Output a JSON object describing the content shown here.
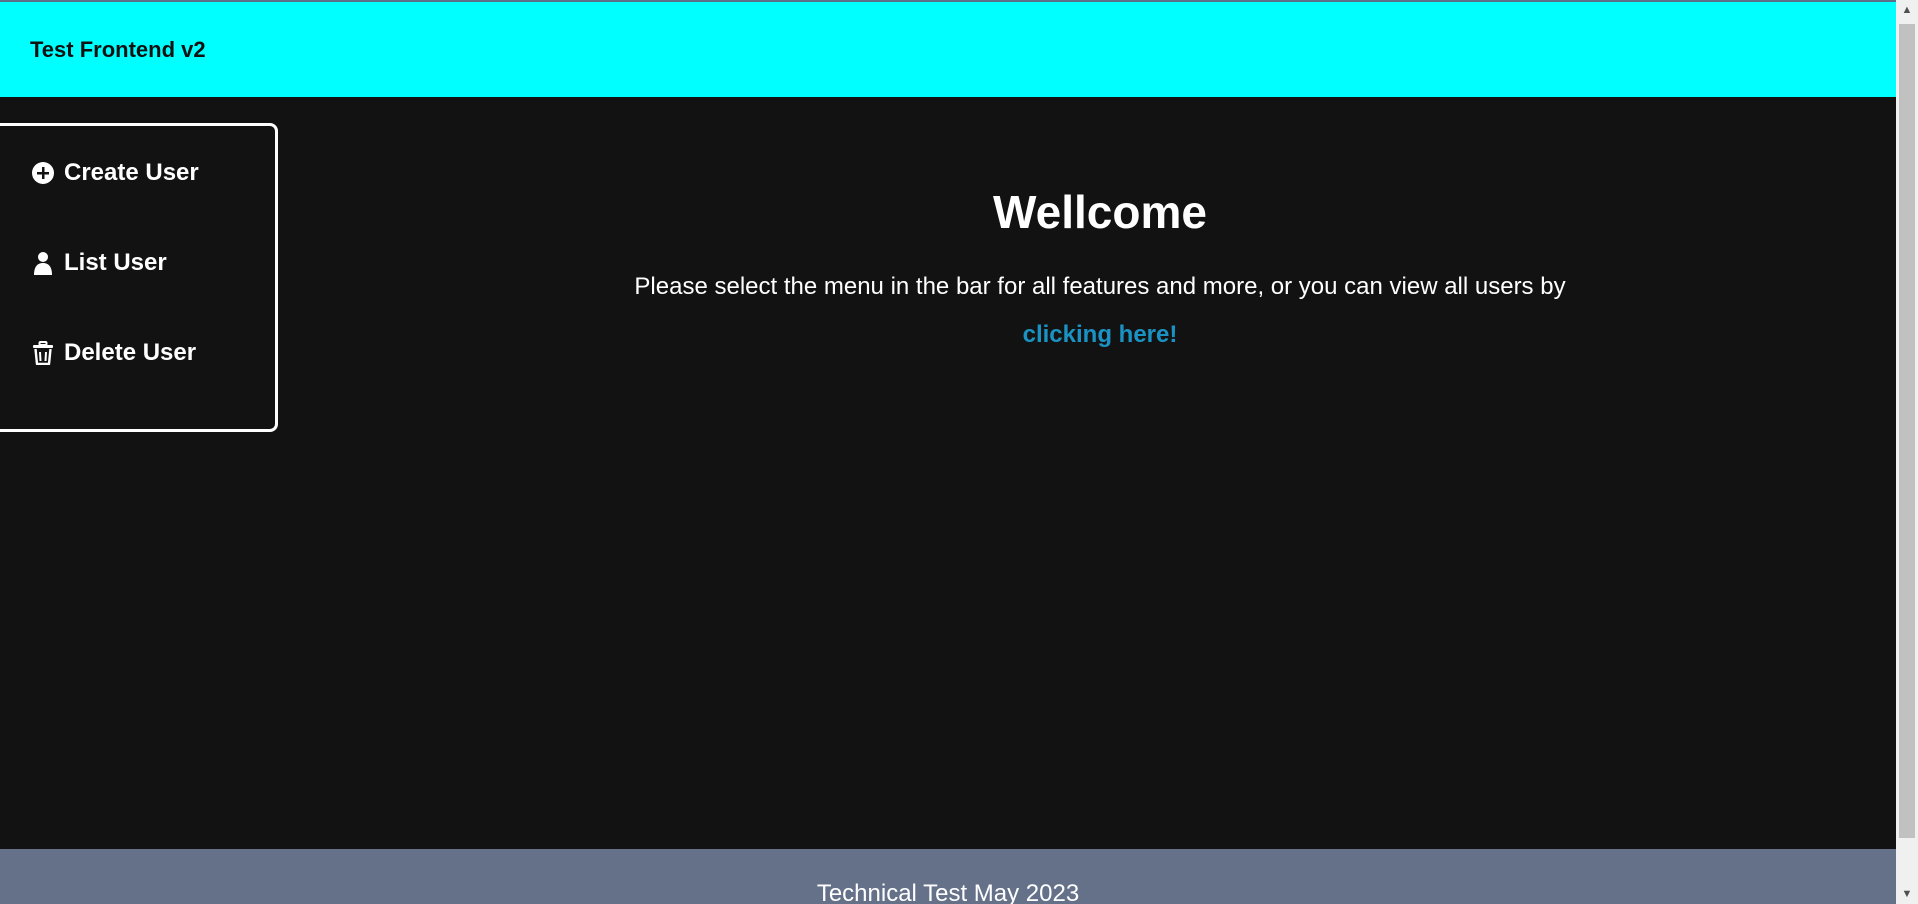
{
  "header": {
    "title": "Test Frontend v2"
  },
  "sidebar": {
    "items": [
      {
        "label": "Create User",
        "icon": "plus-circle-icon"
      },
      {
        "label": "List User",
        "icon": "user-icon"
      },
      {
        "label": "Delete User",
        "icon": "trash-icon"
      }
    ]
  },
  "main": {
    "title": "Wellcome",
    "text": "Please select the menu in the bar for all features and more, or you can view all users by",
    "link": "clicking here!"
  },
  "footer": {
    "text": "Technical Test May 2023"
  },
  "colors": {
    "header_bg": "#00ffff",
    "main_bg": "#121212",
    "link": "#1a93c4",
    "footer_bg": "#647189"
  }
}
